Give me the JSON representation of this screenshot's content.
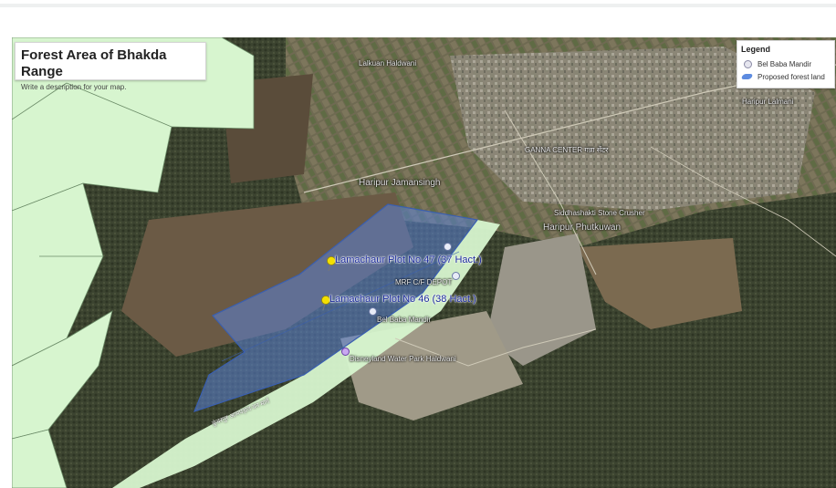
{
  "map": {
    "title": "Forest Area of Bhakda Range",
    "description": "Write a description for your map.",
    "colors": {
      "forest_fill": "#d7f5cf",
      "proposed_fill": "#5a82d6",
      "proposed_border": "#3a5fb0",
      "plot_label": "#1a2a9a"
    },
    "legend": {
      "title": "Legend",
      "items": [
        {
          "label": "Bel Baba Mandir",
          "icon": "point-marker-icon"
        },
        {
          "label": "Proposed forest land",
          "icon": "polygon-icon"
        }
      ]
    },
    "plots": [
      {
        "label": "Lamachaur Plot No 47 (37 Hact.)"
      },
      {
        "label": "Lamachaur Plot No 46 (38 Hact.)"
      }
    ],
    "places": {
      "haripur_jamansingh": "Haripur Jamansingh",
      "haripur_phutkuwan": "Haripur Phutkuwan",
      "haripur_lalmani": "Haripur Lalmani",
      "ganna_center": "GANNA CENTER गन्ना सेंटर",
      "stone_crusher": "Siddhashakti Stone Crusher",
      "mrf_depot": "MRF C/F DEPOT",
      "bel_baba_mandir": "Bel Baba Mandir",
      "water_park": "Disneyland Water Park Haldwani",
      "top_place": "Lalkuan Haldwani",
      "road_label": "कुंवरपुर आमपड़ाव वन मार्ग"
    }
  }
}
